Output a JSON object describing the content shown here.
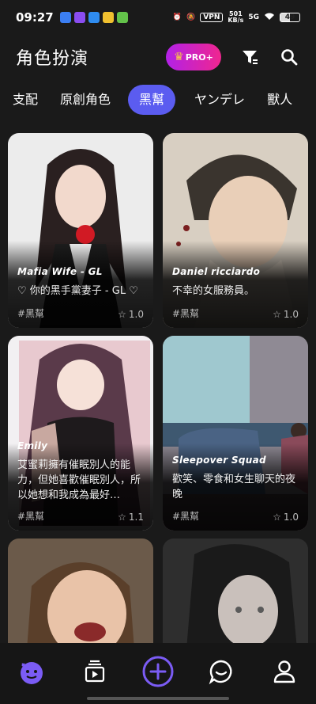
{
  "status_bar": {
    "time": "09:27",
    "vpn": "VPN",
    "net_speed_top": "501",
    "net_speed_bottom": "KB/s",
    "network": "5G",
    "battery": "49"
  },
  "header": {
    "title": "角色扮演",
    "pro_label": "PRO+"
  },
  "tabs": [
    {
      "label": "支配"
    },
    {
      "label": "原創角色"
    },
    {
      "label": "黑幫",
      "active": true
    },
    {
      "label": "ヤンデレ"
    },
    {
      "label": "獸人"
    }
  ],
  "cards": [
    {
      "name": "Mafia Wife - GL",
      "desc": "♡ 你的黑手黨妻子 - GL ♡",
      "tag": "#黑幫",
      "rating": "1.0"
    },
    {
      "name": "Daniel ricciardo",
      "desc": "不幸的女服務員。",
      "tag": "#黑幫",
      "rating": "1.0"
    },
    {
      "name": "Emily",
      "desc": "艾蜜莉擁有催眠別人的能力，但她喜歡催眠別人，所以她想和我成為最好…",
      "tag": "#黑幫",
      "rating": "1.1"
    },
    {
      "name": "Sleepover Squad",
      "desc": "歡笑、零食和女生聊天的夜晚",
      "tag": "#黑幫",
      "rating": "1.0"
    },
    {
      "name": "",
      "desc": "",
      "tag": "",
      "rating": ""
    },
    {
      "name": "",
      "desc": "",
      "tag": "",
      "rating": ""
    }
  ],
  "colors": {
    "background": "#1a1a1a",
    "accent": "#5b5cf0",
    "pro_gradient_start": "#b221e8",
    "pro_gradient_end": "#f0268f",
    "nav_active": "#7b5cf5"
  },
  "bottom_nav": [
    {
      "icon": "mascot-icon",
      "active": true
    },
    {
      "icon": "stack-play-icon"
    },
    {
      "icon": "plus-circle-icon"
    },
    {
      "icon": "chat-bubble-icon"
    },
    {
      "icon": "profile-icon"
    }
  ]
}
